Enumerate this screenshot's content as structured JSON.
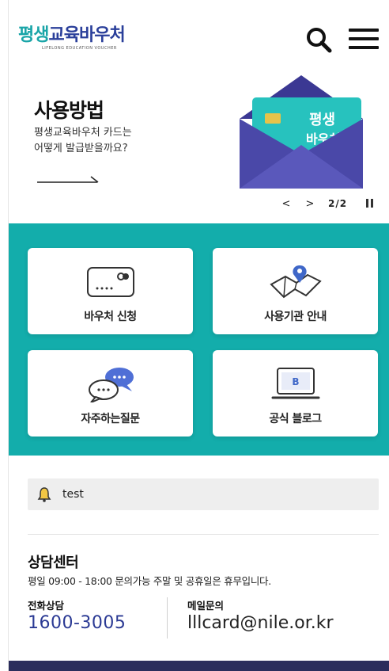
{
  "header": {
    "logo_text_1": "평생",
    "logo_text_2": "교육바우처",
    "logo_sub": "LIFELONG EDUCATION VOUCHER"
  },
  "banner": {
    "title": "사용방법",
    "description": "평생교육바우처 카드는\n어떻게 발급받을까요?",
    "card_text_1": "평생",
    "card_text_2": "바우처",
    "pager": {
      "prev": "<",
      "next": ">",
      "count": "2/2"
    }
  },
  "quick_menu": [
    {
      "label": "바우처 신청",
      "icon": "card-icon"
    },
    {
      "label": "사용기관 안내",
      "icon": "map-pin-icon"
    },
    {
      "label": "자주하는질문",
      "icon": "chat-bubbles-icon"
    },
    {
      "label": "공식 블로그",
      "icon": "monitor-blog-icon",
      "icon_letter": "B"
    }
  ],
  "notice": {
    "text": "test"
  },
  "contact": {
    "title": "상담센터",
    "hours": "평일 09:00 - 18:00 문의가능 주말 및 공휴일은 휴무입니다.",
    "phone_label": "전화상담",
    "phone_number": "1600-3005",
    "mail_label": "메일문의",
    "mail_address": "lllcard@nile.or.kr"
  },
  "colors": {
    "teal": "#13adab",
    "navy": "#2b3a94",
    "footer": "#2b2d5c",
    "envelope": "#4a48a8"
  }
}
